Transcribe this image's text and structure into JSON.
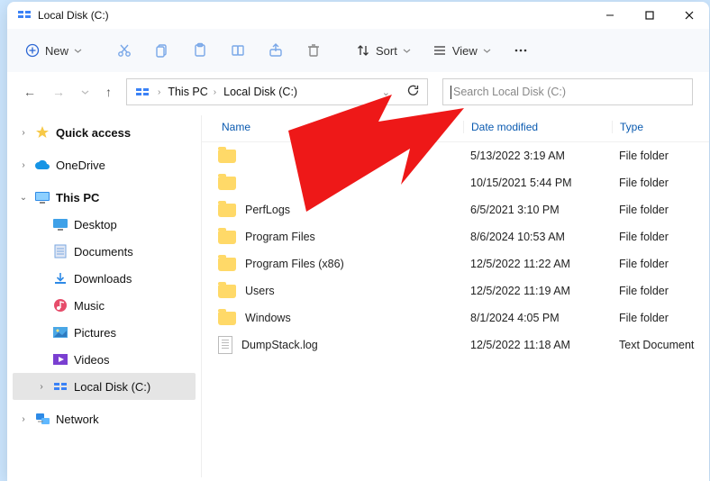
{
  "title": "Local Disk (C:)",
  "toolbar": {
    "new": "New",
    "sort": "Sort",
    "view": "View"
  },
  "breadcrumb": {
    "root": "This PC",
    "current": "Local Disk (C:)"
  },
  "search": {
    "placeholder": "Search Local Disk (C:)"
  },
  "sidebar": {
    "quick_access": "Quick access",
    "onedrive": "OneDrive",
    "this_pc": "This PC",
    "desktop": "Desktop",
    "documents": "Documents",
    "downloads": "Downloads",
    "music": "Music",
    "pictures": "Pictures",
    "videos": "Videos",
    "local_disk": "Local Disk (C:)",
    "network": "Network"
  },
  "columns": {
    "name": "Name",
    "date": "Date modified",
    "type": "Type"
  },
  "rows": [
    {
      "name": "",
      "date": "5/13/2022 3:19 AM",
      "type": "File folder",
      "icon": "folder"
    },
    {
      "name": "",
      "date": "10/15/2021 5:44 PM",
      "type": "File folder",
      "icon": "folder"
    },
    {
      "name": "PerfLogs",
      "date": "6/5/2021 3:10 PM",
      "type": "File folder",
      "icon": "folder"
    },
    {
      "name": "Program Files",
      "date": "8/6/2024 10:53 AM",
      "type": "File folder",
      "icon": "folder"
    },
    {
      "name": "Program Files (x86)",
      "date": "12/5/2022 11:22 AM",
      "type": "File folder",
      "icon": "folder"
    },
    {
      "name": "Users",
      "date": "12/5/2022 11:19 AM",
      "type": "File folder",
      "icon": "folder"
    },
    {
      "name": "Windows",
      "date": "8/1/2024 4:05 PM",
      "type": "File folder",
      "icon": "folder"
    },
    {
      "name": "DumpStack.log",
      "date": "12/5/2022 11:18 AM",
      "type": "Text Document",
      "icon": "doc"
    }
  ]
}
